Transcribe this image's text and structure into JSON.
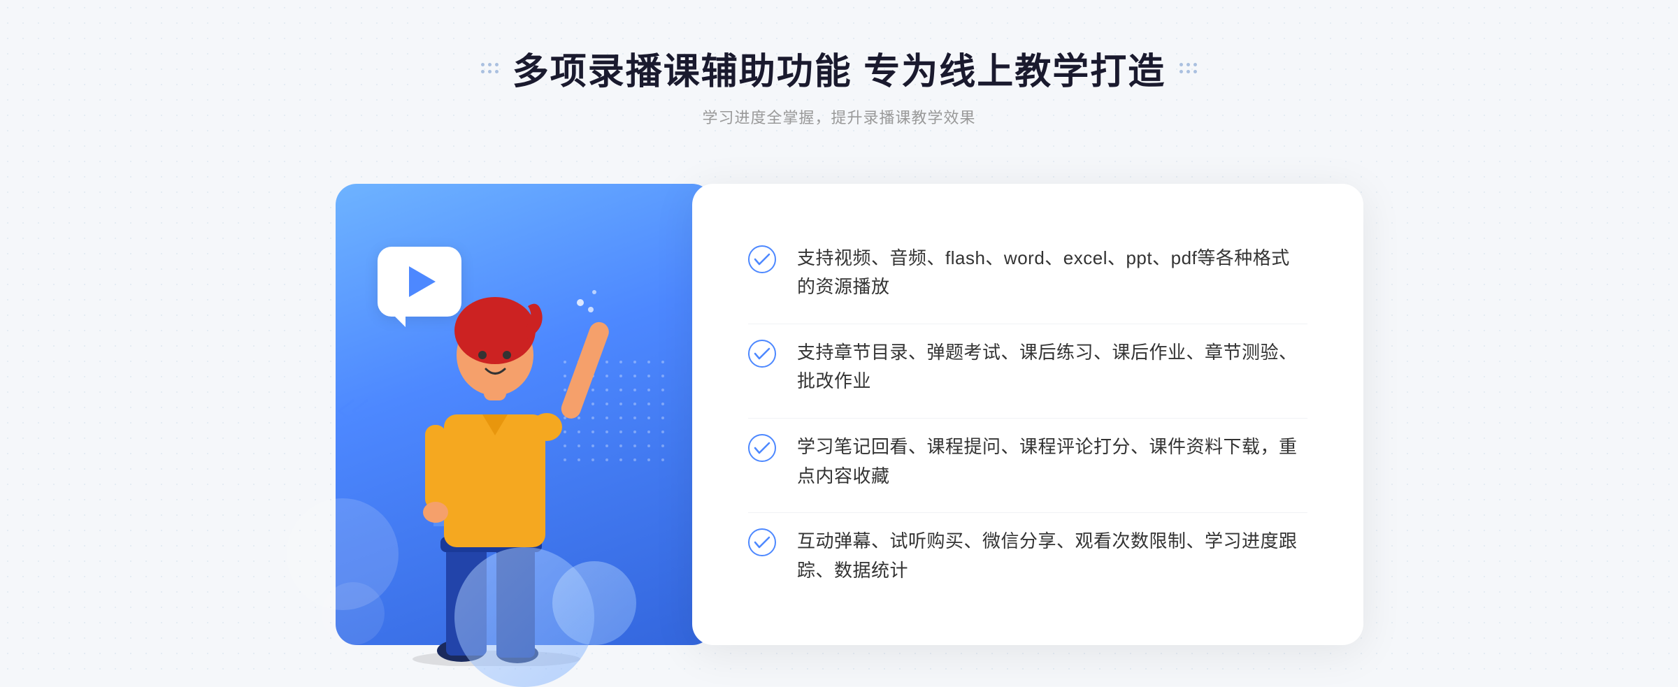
{
  "header": {
    "main_title": "多项录播课辅助功能 专为线上教学打造",
    "subtitle": "学习进度全掌握，提升录播课教学效果"
  },
  "features": [
    {
      "id": "feature-1",
      "text": "支持视频、音频、flash、word、excel、ppt、pdf等各种格式的资源播放"
    },
    {
      "id": "feature-2",
      "text": "支持章节目录、弹题考试、课后练习、课后作业、章节测验、批改作业"
    },
    {
      "id": "feature-3",
      "text": "学习笔记回看、课程提问、课程评论打分、课件资料下载，重点内容收藏"
    },
    {
      "id": "feature-4",
      "text": "互动弹幕、试听购买、微信分享、观看次数限制、学习进度跟踪、数据统计"
    }
  ],
  "colors": {
    "primary_blue": "#4d88ff",
    "dark_blue": "#3366dd",
    "light_blue": "#7baeff",
    "text_dark": "#1a1a2e",
    "text_medium": "#333",
    "text_light": "#999"
  },
  "icons": {
    "check": "circle-check",
    "play": "play-triangle",
    "chevron": "double-chevron"
  }
}
